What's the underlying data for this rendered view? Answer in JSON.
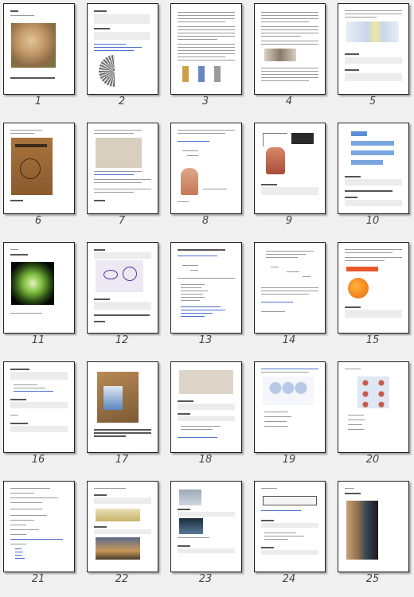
{
  "thumbnails": [
    {
      "page": "1"
    },
    {
      "page": "2"
    },
    {
      "page": "3"
    },
    {
      "page": "4"
    },
    {
      "page": "5"
    },
    {
      "page": "6"
    },
    {
      "page": "7"
    },
    {
      "page": "8"
    },
    {
      "page": "9"
    },
    {
      "page": "10"
    },
    {
      "page": "11"
    },
    {
      "page": "12"
    },
    {
      "page": "13"
    },
    {
      "page": "14"
    },
    {
      "page": "15"
    },
    {
      "page": "16"
    },
    {
      "page": "17"
    },
    {
      "page": "18"
    },
    {
      "page": "19"
    },
    {
      "page": "20"
    },
    {
      "page": "21"
    },
    {
      "page": "22"
    },
    {
      "page": "23"
    },
    {
      "page": "24"
    },
    {
      "page": "25"
    }
  ],
  "colors": {
    "background": "#f0f0f0",
    "page": "#ffffff",
    "border": "#222222",
    "label": "#444444"
  }
}
